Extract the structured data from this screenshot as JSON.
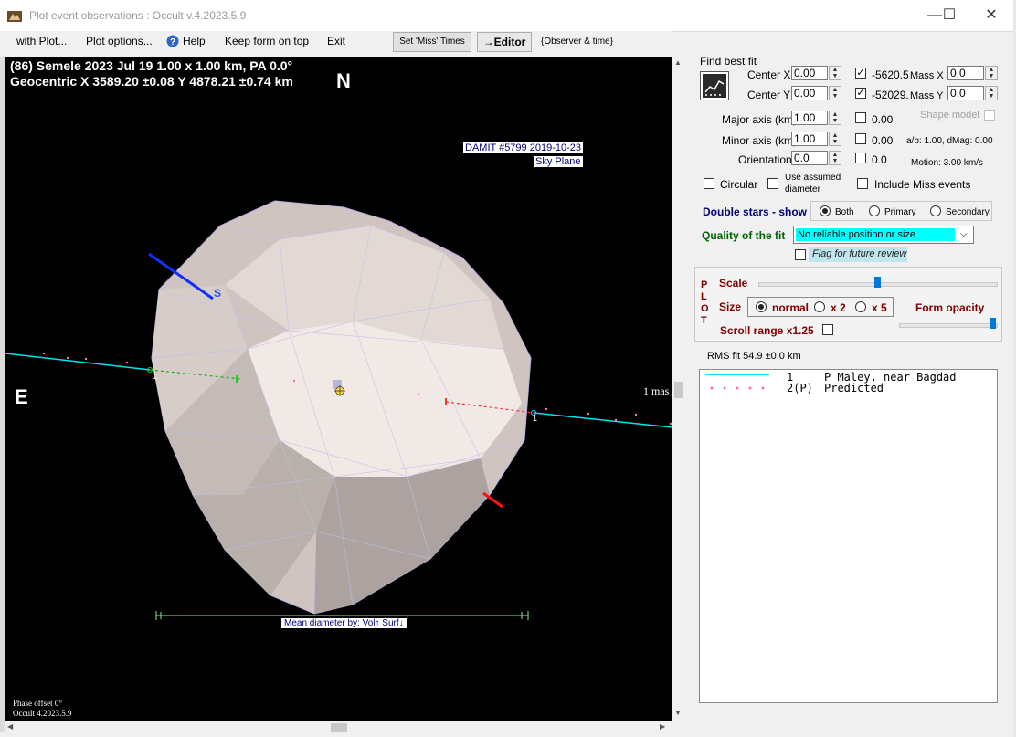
{
  "window": {
    "title": "Plot event observations : Occult v.4.2023.5.9",
    "minimize": "—",
    "maximize": "☐",
    "close": "✕"
  },
  "menu": {
    "items": [
      "with Plot...",
      "Plot options...",
      "Help",
      "Keep form on top",
      "Exit"
    ],
    "set_miss_times": "Set 'Miss' Times",
    "editor": "→Editor",
    "observer_time": "{Observer & time}"
  },
  "plot": {
    "header_line1": "(86) Semele  2023 Jul 19   1.00 x 1.00 km,  PA 0.0°",
    "header_line2": "Geocentric  X  3589.20 ±0.08  Y 4878.21 ±0.74 km",
    "north": "N",
    "east": "E",
    "damit_line1": "DAMIT #5799 2019-10-23",
    "damit_line2": "Sky Plane",
    "scale_label": "1 mas",
    "s_label": "S",
    "chord_label_left": "1",
    "chord_label_right": "1",
    "mean_diameter": "Mean diameter by: Vol↑ Surf↓",
    "phase_offset": "Phase offset 0°",
    "version": "Occult 4.2023.5.9"
  },
  "fit": {
    "find_best_fit": "Find best fit",
    "center_x_label": "Center X",
    "center_x": "0.00",
    "center_y_label": "Center Y",
    "center_y": "0.00",
    "val_x": "-5620.52",
    "val_y": "-52029.0",
    "mass_x_label": "Mass X",
    "mass_x": "0.0",
    "mass_y_label": "Mass Y",
    "mass_y": "0.0",
    "major_label": "Major axis (km)",
    "major": "1.00",
    "major_chk": "0.00",
    "minor_label": "Minor axis (km)",
    "minor": "1.00",
    "minor_chk": "0.00",
    "orient_label": "Orientation",
    "orient": "0.0",
    "orient_chk": "0.0",
    "shape_model": "Shape model",
    "ab_dmag": "a/b: 1.00, dMag: 0.00",
    "motion": "Motion: 3.00 km/s",
    "circular": "Circular",
    "use_assumed_1": "Use assumed",
    "use_assumed_2": "diameter",
    "include_miss": "Include Miss events"
  },
  "double_stars": {
    "label": "Double stars - show",
    "both": "Both",
    "primary": "Primary",
    "secondary": "Secondary"
  },
  "quality": {
    "label": "Quality of the fit",
    "value": "No reliable position or size",
    "flag": "Flag for future review"
  },
  "plot_panel": {
    "vertical_letters": [
      "P",
      "L",
      "O",
      "T"
    ],
    "scale": "Scale",
    "size": "Size",
    "normal": "normal",
    "x2": "x 2",
    "x5": "x 5",
    "form_opacity": "Form opacity",
    "scroll_range": "Scroll range x1.25",
    "scale_level": 0.5,
    "opacity_level": 1.0
  },
  "rms": "RMS fit 54.9 ±0.0 km",
  "legend": [
    {
      "num": "1",
      "name": "P Maley, near Bagdad",
      "color": "#00e5ee",
      "style": "solid"
    },
    {
      "num": "2(P)",
      "name": "Predicted",
      "color": "#ff6fae",
      "style": "dots"
    }
  ],
  "colors": {
    "chord_cyan": "#00e5ee",
    "predicted_pink": "#ff6fae",
    "selection_cyan": "#00ffff",
    "navy": "#00007a",
    "green": "#006400",
    "maroon": "#800000"
  }
}
